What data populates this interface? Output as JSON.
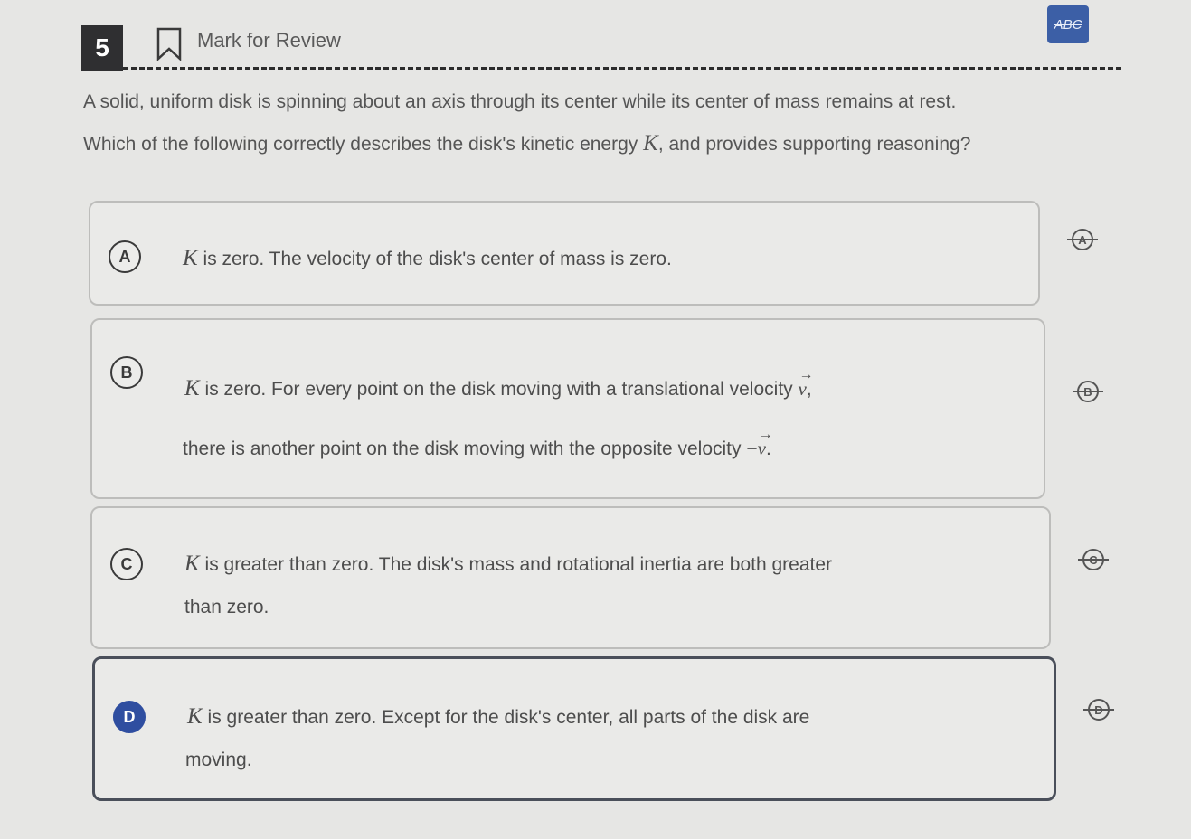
{
  "header": {
    "question_number": "5",
    "mark_label": "Mark for Review",
    "abc_label": "ABC"
  },
  "question": {
    "line1": "A solid, uniform disk is spinning about an axis through its center while its center of mass remains at rest.",
    "line2_before": "Which of the following correctly describes the disk's kinetic energy",
    "line2_var": "K",
    "line2_after": ", and provides supporting reasoning?"
  },
  "options": [
    {
      "letter": "A",
      "var": "K",
      "text": " is zero. The velocity of the disk's center of mass is zero."
    },
    {
      "letter": "B",
      "var": "K",
      "text1": " is zero. For every point on the disk moving with a translational velocity ",
      "vec1": "v",
      "text1_end": ",",
      "text2": "there is another point on the disk moving with the opposite velocity ",
      "vec2_sign": "−",
      "vec2": "v",
      "text2_end": "."
    },
    {
      "letter": "C",
      "var": "K",
      "text1": " is greater than zero. The disk's mass and rotational inertia are both greater",
      "text2": "than zero."
    },
    {
      "letter": "D",
      "var": "K",
      "text1": " is greater than zero. Except for the disk's center, all parts of the disk are",
      "text2": "moving."
    }
  ],
  "selected_option": "D",
  "colors": {
    "accent": "#2f4ea0",
    "qnum_bg": "#2f2f31"
  }
}
